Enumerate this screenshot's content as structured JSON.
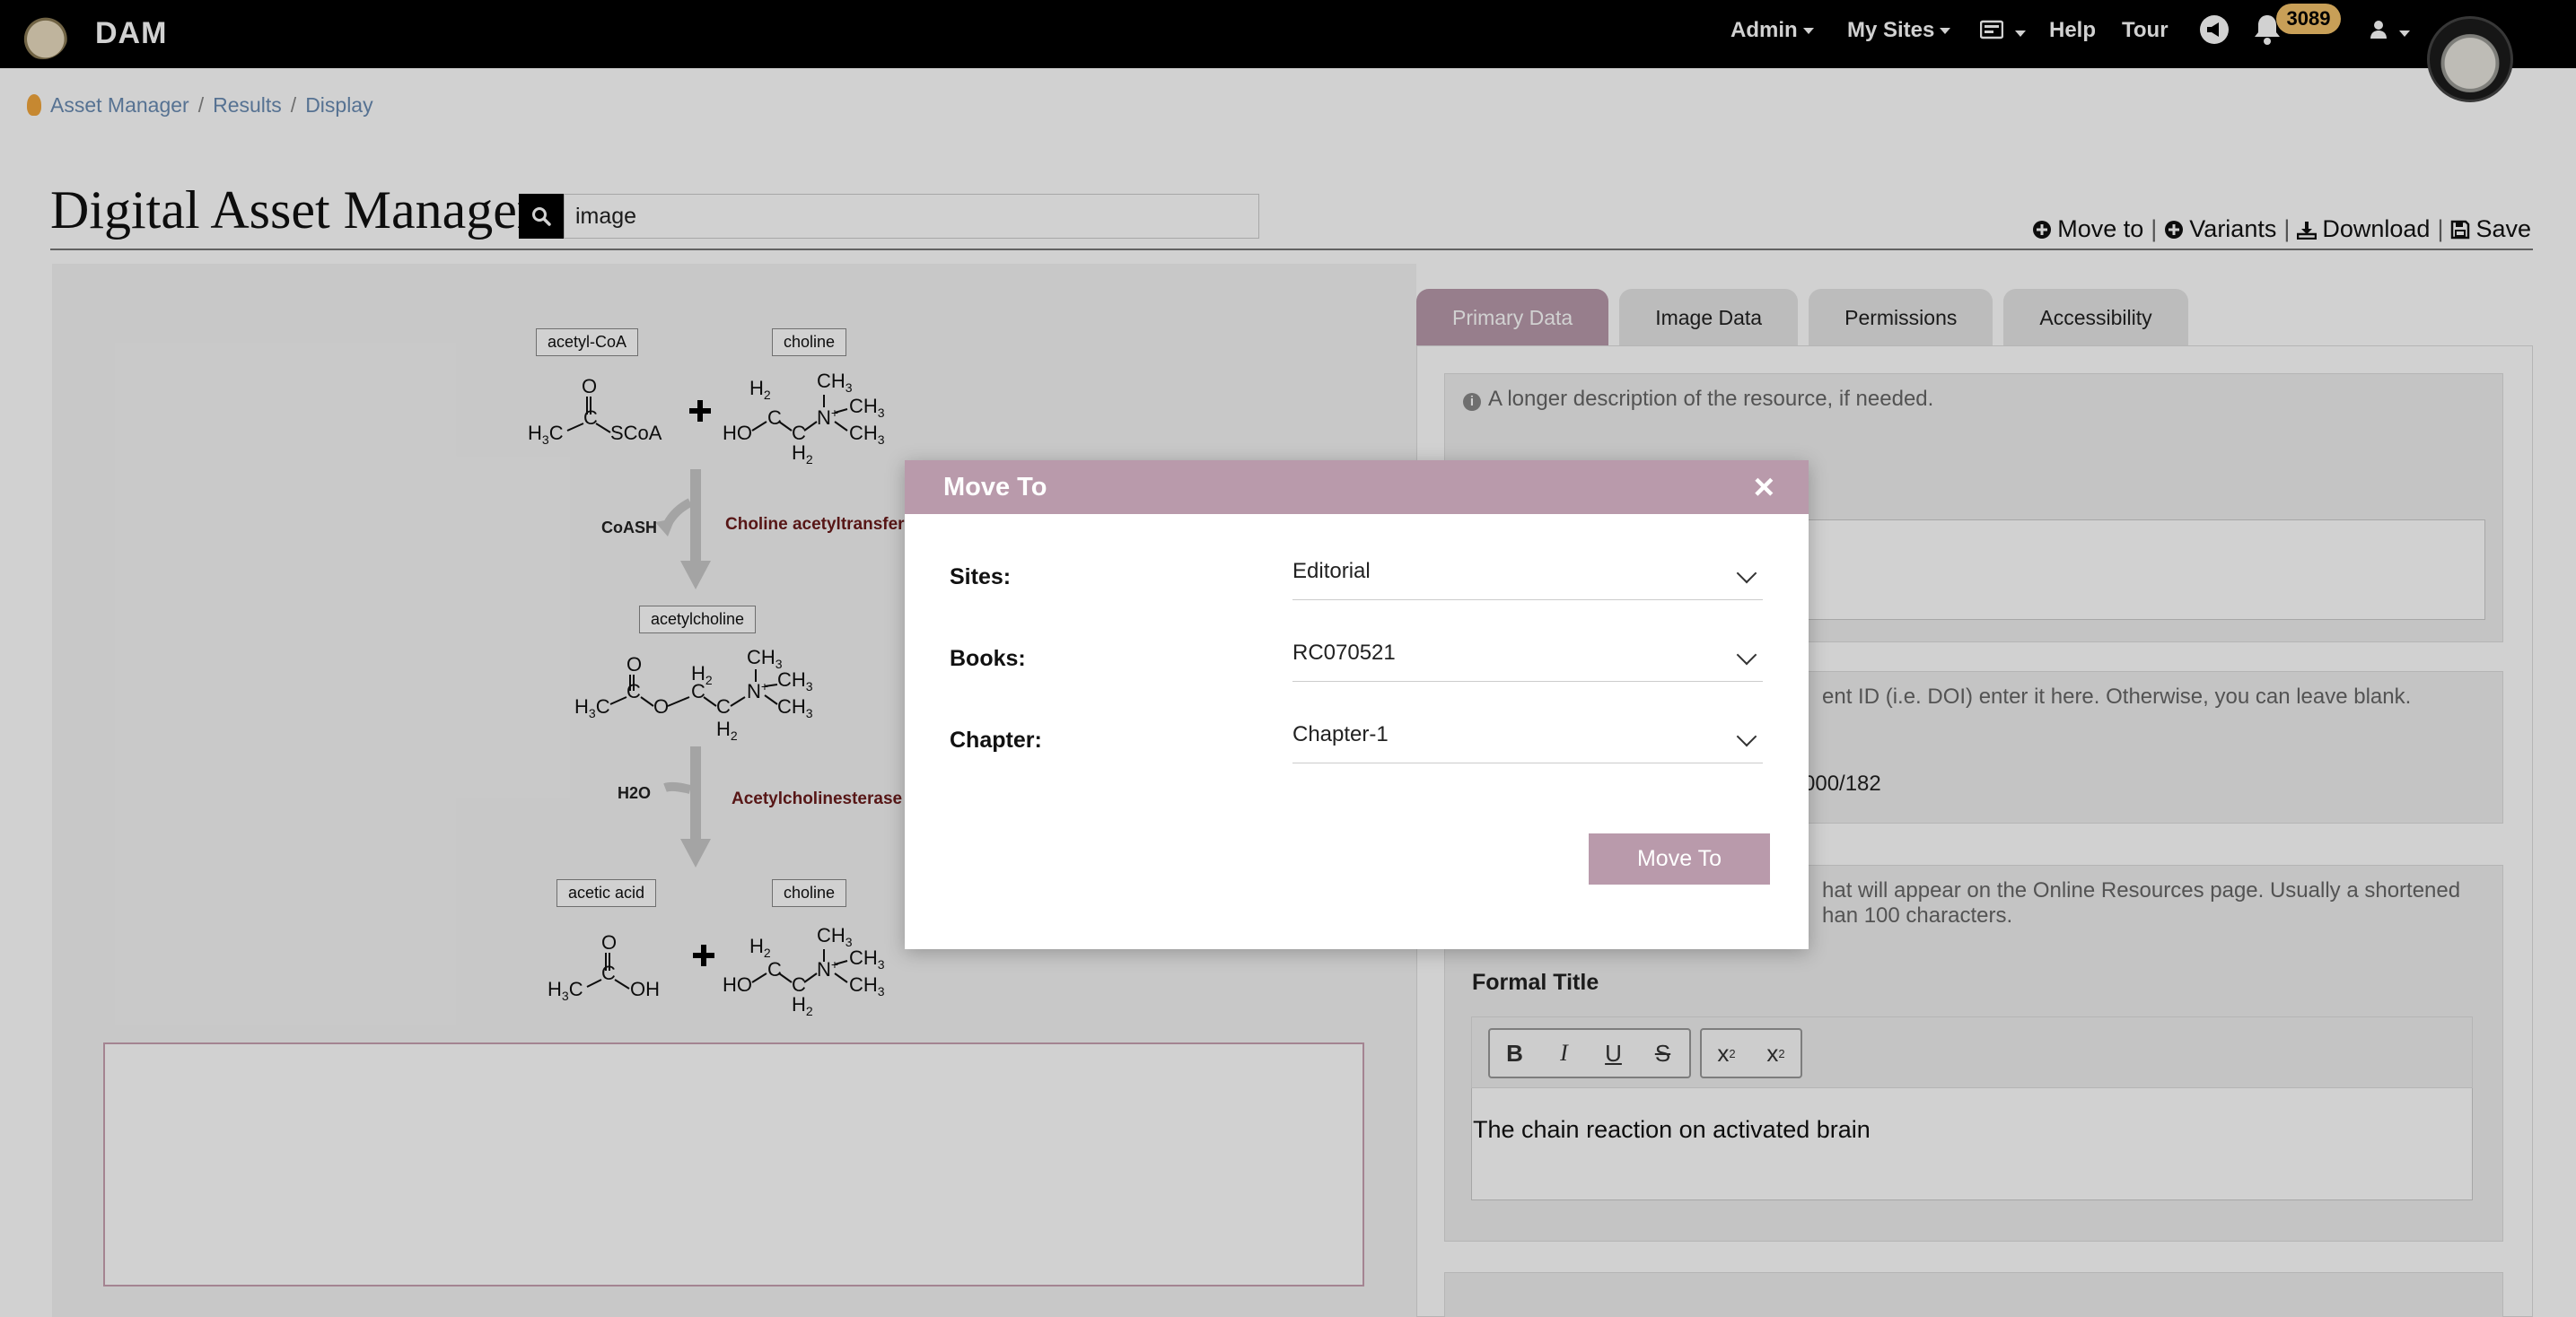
{
  "app": {
    "brand": "DAM"
  },
  "nav": {
    "admin": "Admin",
    "my_sites": "My Sites",
    "help": "Help",
    "tour": "Tour",
    "notification_count": "3089"
  },
  "breadcrumb": [
    "Asset Manager",
    "Results",
    "Display"
  ],
  "page": {
    "title": "Digital Asset Manager"
  },
  "search": {
    "value": "image"
  },
  "actions": {
    "move_to": "Move to",
    "variants": "Variants",
    "download": "Download",
    "save": "Save"
  },
  "diagram": {
    "labels": [
      "acetyl-CoA",
      "choline",
      "acetylcholine",
      "acetic acid",
      "choline"
    ],
    "cofactor1": "CoASH",
    "enzyme1": "Choline acetyltransfer",
    "cofactor2": "H2O",
    "enzyme2": "Acetylcholinesterase"
  },
  "tabs": [
    "Primary Data",
    "Image Data",
    "Permissions",
    "Accessibility"
  ],
  "form": {
    "description_help": "A longer description of the resource, if needed.",
    "doi_help": "ent ID (i.e. DOI) enter it here. Otherwise, you can leave blank.",
    "doi_value": "000/182",
    "title_help_1": "hat will appear on the Online Resources page. Usually a shortened",
    "title_help_2": "han 100 characters.",
    "formal_title_label": "Formal Title",
    "formal_title_value": "The chain reaction on activated brain"
  },
  "modal": {
    "title": "Move To",
    "sites_label": "Sites:",
    "sites_value": "Editorial",
    "books_label": "Books:",
    "books_value": "RC070521",
    "chapter_label": "Chapter:",
    "chapter_value": "Chapter-1",
    "submit_label": "Move To"
  },
  "colors": {
    "accent": "#b99aab",
    "topbar": "#000000",
    "badge": "#f5c26b",
    "enzyme_text": "#6b1b1b"
  }
}
